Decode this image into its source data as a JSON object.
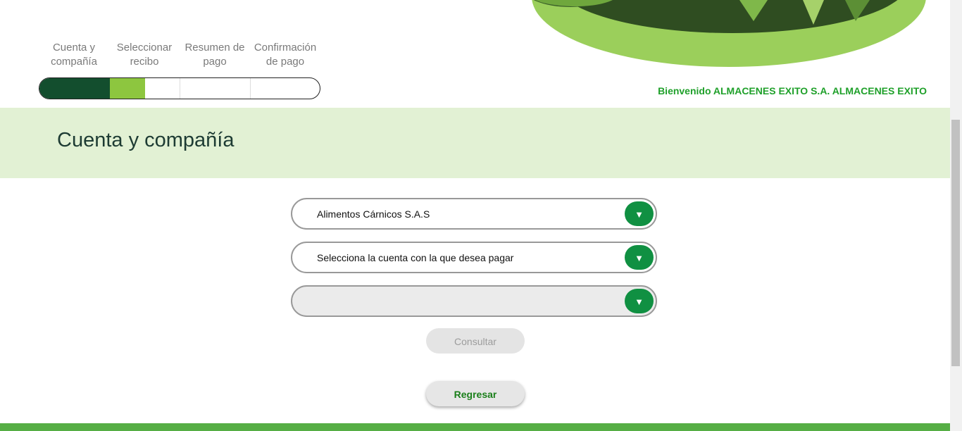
{
  "steps": [
    "Cuenta y compañía",
    "Seleccionar recibo",
    "Resumen de pago",
    "Confirmación de pago"
  ],
  "progress": {
    "completed_color": "#134e2e",
    "current_color": "#8dc63f",
    "empty_color": "#ffffff"
  },
  "welcome": "Bienvenido ALMACENES EXITO S.A. ALMACENES EXITO",
  "page_title": "Cuenta y compañía",
  "selects": {
    "company": "Alimentos Cárnicos S.A.S",
    "account": "Selecciona la cuenta con la que desea pagar",
    "third": ""
  },
  "buttons": {
    "consultar": "Consultar",
    "regresar": "Regresar"
  },
  "colors": {
    "accent_green": "#109042",
    "band": "#e2f1d4",
    "footer": "#56ae45"
  }
}
